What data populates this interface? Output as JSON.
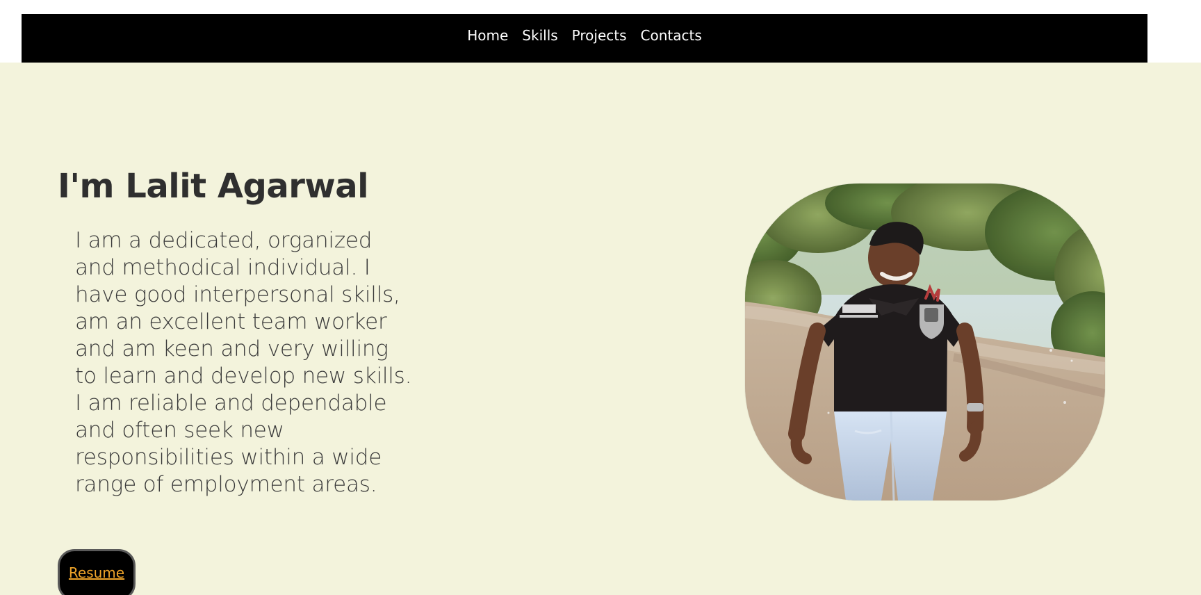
{
  "nav": {
    "items": [
      "Home",
      "Skills",
      "Projects",
      "Contacts"
    ]
  },
  "hero": {
    "title": "I'm Lalit Agarwal",
    "bio": "I am a dedicated, organized and methodical individual. I have good interpersonal skills, am an excellent team worker and am keen and very willing to learn and develop new skills. I am reliable and dependable and often seek new responsibilities within a wide range of employment areas.",
    "resume_label": "Resume"
  }
}
